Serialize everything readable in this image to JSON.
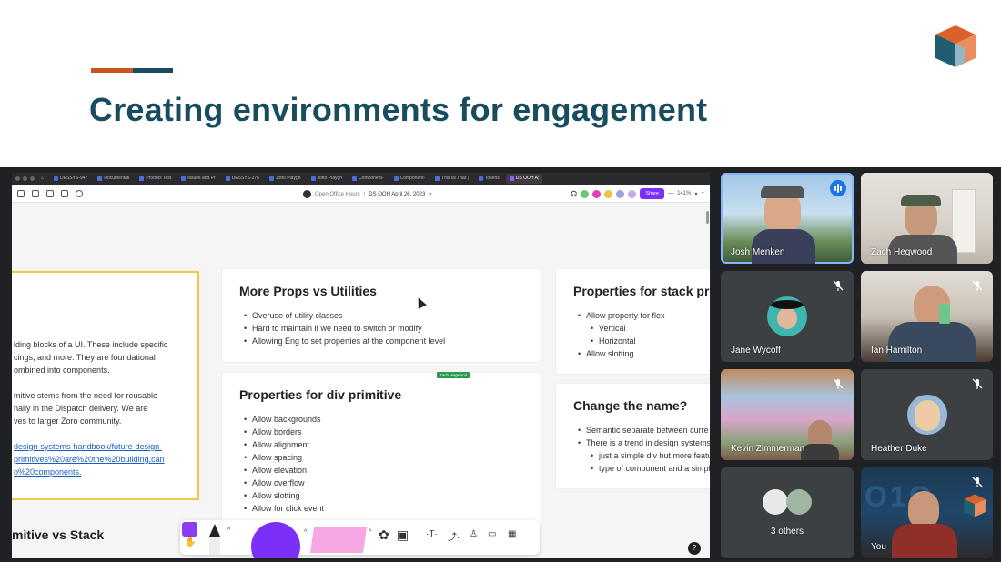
{
  "slide": {
    "title": "Creating environments for engagement",
    "accent_colors": [
      "#c9541f",
      "#174d5e"
    ],
    "title_color": "#174d5e"
  },
  "browser": {
    "tabs": [
      {
        "label": "DESSYS-947",
        "active": false
      },
      {
        "label": "Documentati",
        "active": false
      },
      {
        "label": "Product Test",
        "active": false
      },
      {
        "label": "Issues and Pr",
        "active": false
      },
      {
        "label": "DESSYS-276",
        "active": false
      },
      {
        "label": "Jotto Playgn",
        "active": false
      },
      {
        "label": "Jotto Playgn",
        "active": false
      },
      {
        "label": "Component-",
        "active": false
      },
      {
        "label": "Component-",
        "active": false
      },
      {
        "label": "This vs That |",
        "active": false
      },
      {
        "label": "Tokens",
        "active": false
      },
      {
        "label": "DS OOH A;",
        "active": true
      }
    ],
    "breadcrumb_team": "Open Office Hours",
    "breadcrumb_separator": "/",
    "breadcrumb_file": "DS OOH April 26, 2023",
    "share_label": "Share",
    "zoom": "141%"
  },
  "canvas": {
    "left_card": {
      "lines": [
        "lding blocks of a UI. These include specific",
        "cings, and more. They are foundational",
        "ombined into components.",
        "",
        "mitive stems from the need for reusable",
        "nally in the Dispatch delivery. We are",
        "ves to larger Zoro community."
      ],
      "link_lines": [
        "design-systems-handbook/future-design-",
        "primitives%20are%20the%20building,can",
        "o%20components."
      ]
    },
    "cards": [
      {
        "title": "More Props vs Utilities",
        "items": [
          {
            "text": "Overuse of utility classes",
            "sub": false
          },
          {
            "text": "Hard to maintain if we need to switch or modify",
            "sub": false
          },
          {
            "text": "Allowing Eng to set properties at the component level",
            "sub": false
          }
        ]
      },
      {
        "title": "Properties for div primitive",
        "items": [
          {
            "text": "Allow backgrounds",
            "sub": false
          },
          {
            "text": "Allow borders",
            "sub": false
          },
          {
            "text": "Allow alignment",
            "sub": false
          },
          {
            "text": "Allow spacing",
            "sub": false
          },
          {
            "text": "Allow elevation",
            "sub": false
          },
          {
            "text": "Allow overflow",
            "sub": false
          },
          {
            "text": "Allow slotting",
            "sub": false
          },
          {
            "text": "Allow for click event",
            "sub": false
          }
        ]
      },
      {
        "title": "Properties for stack pri",
        "items": [
          {
            "text": "Allow property for flex",
            "sub": false
          },
          {
            "text": "Vertical",
            "sub": true
          },
          {
            "text": "Horizontal",
            "sub": true
          },
          {
            "text": "Allow slotting",
            "sub": false
          }
        ]
      },
      {
        "title": "Change the name?",
        "items": [
          {
            "text": "Semantic separate between curre",
            "sub": false
          },
          {
            "text": "There is a trend in design systems",
            "sub": false
          },
          {
            "text": "just a simple div but more feature",
            "sub": true
          },
          {
            "text": "type of component and a simple c",
            "sub": true
          }
        ]
      }
    ],
    "cursor_name_tag": "Zach Hegwood",
    "bottom_heading": "mitive vs Stack",
    "help_label": "?"
  },
  "participants": [
    {
      "name": "Josh Menken",
      "muted": false,
      "speaking": true
    },
    {
      "name": "Zach Hegwood",
      "muted": false,
      "speaking": false
    },
    {
      "name": "Jane Wycoff",
      "muted": true,
      "speaking": false
    },
    {
      "name": "Ian Hamilton",
      "muted": true,
      "speaking": false
    },
    {
      "name": "Kevin Zimmerman",
      "muted": true,
      "speaking": false
    },
    {
      "name": "Heather Duke",
      "muted": true,
      "speaking": false
    },
    {
      "name": "3 others",
      "muted": false,
      "speaking": false
    },
    {
      "name": "You",
      "muted": true,
      "speaking": false
    }
  ]
}
